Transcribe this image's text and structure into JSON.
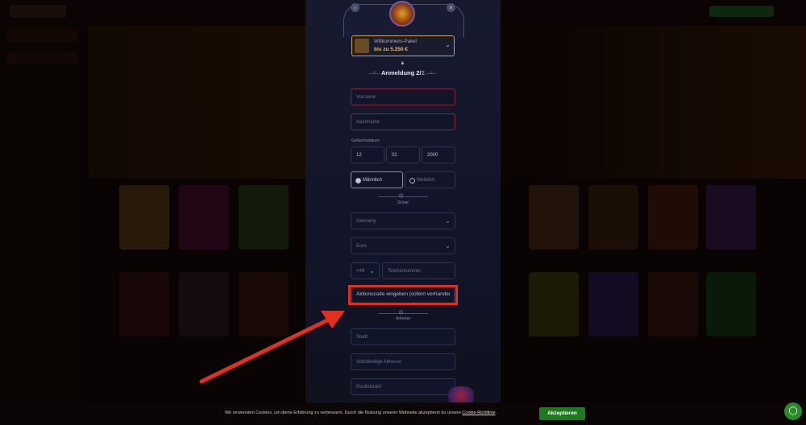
{
  "modal": {
    "prev_icon": "chevron-left-icon",
    "close_icon": "close-icon",
    "bonus": {
      "title": "Willkommens-Paket",
      "amount": "bis zu 5.250 €",
      "chevron": "⌄"
    },
    "step_label": "Anmeldung 2/",
    "step_total": "2",
    "fields": {
      "first_name": "Vorname",
      "last_name": "Nachname",
      "birthdate_label": "Geburtsdatum",
      "day": "12",
      "month": "02",
      "year": "2000",
      "gender_male": "Männlich",
      "gender_female": "Weiblich",
      "security_label": "Sicher",
      "country": "Germany",
      "currency": "Euro",
      "phone_prefix": "+49",
      "phone": "Telefonnummer",
      "promo_code": "Aktionscode eingeben (sofern vorhanden)",
      "address_label": "Adresse",
      "city": "Stadt",
      "full_address": "Vollständige Adresse",
      "postal_code": "Postleitzahl"
    }
  },
  "cookie": {
    "text": "Wir verwenden Cookies, um deine Erfahrung zu verbessern. Durch die Nutzung unserer Webseite akzeptierst du unsere Cookie-Richtlinie.",
    "link": "Cookie-Richtlinie",
    "accept": "Akzeptieren"
  },
  "colors": {
    "highlight": "#e23020",
    "accept": "#1f7a1f",
    "gold": "#c9a74a"
  }
}
